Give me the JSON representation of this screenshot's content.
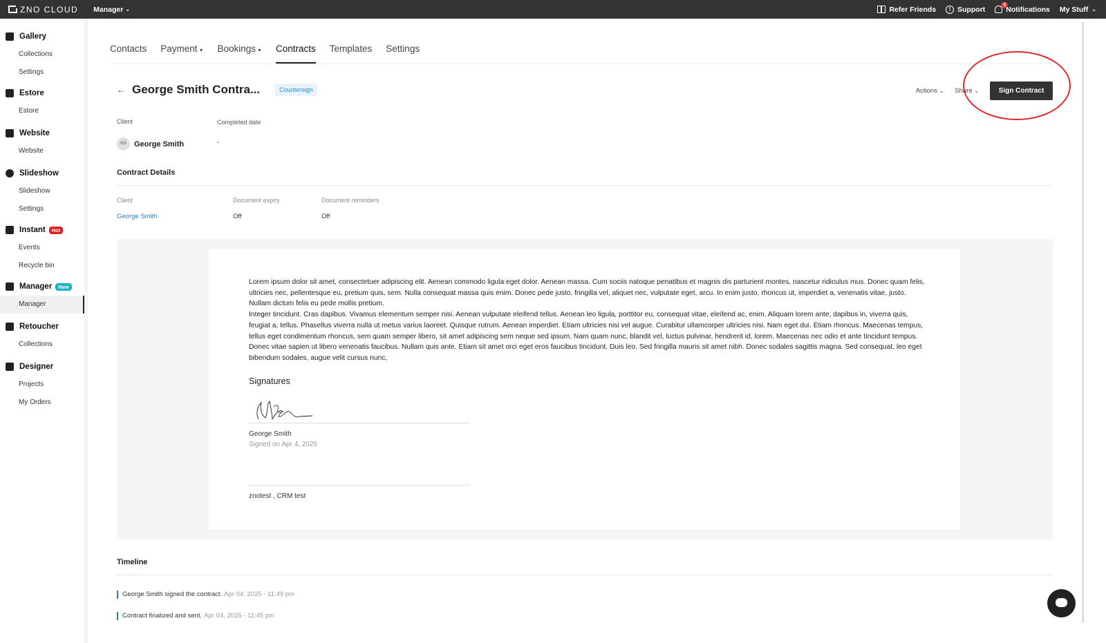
{
  "topbar": {
    "brand": "ZNO CLOUD",
    "module": "Manager",
    "refer": "Refer Friends",
    "support": "Support",
    "notifications": "Notifications",
    "notification_count": "3",
    "my_stuff": "My Stuff"
  },
  "sidebar": {
    "gallery": "Gallery",
    "gallery_collections": "Collections",
    "gallery_settings": "Settings",
    "estore": "Estore",
    "estore_sub": "Estore",
    "website": "Website",
    "website_sub": "Website",
    "slideshow": "Slideshow",
    "slideshow_sub": "Slideshow",
    "slideshow_settings": "Settings",
    "instant": "Instant",
    "instant_badge": "Hot",
    "instant_events": "Events",
    "instant_recycle": "Recycle bin",
    "manager": "Manager",
    "manager_badge": "New",
    "manager_sub": "Manager",
    "retoucher": "Retoucher",
    "retoucher_collections": "Collections",
    "designer": "Designer",
    "designer_projects": "Projects",
    "designer_orders": "My Orders"
  },
  "tabs": {
    "contacts": "Contacts",
    "payment": "Payment",
    "bookings": "Bookings",
    "contracts": "Contracts",
    "templates": "Templates",
    "settings": "Settings"
  },
  "header": {
    "title": "George Smith Contra...",
    "status": "Countersign",
    "actions": "Actions",
    "share": "Share",
    "sign_button": "Sign Contract"
  },
  "info": {
    "client_label": "Client",
    "client_initials": "GS",
    "client_name": "George Smith",
    "completed_label": "Completed date",
    "completed_value": "-"
  },
  "details": {
    "title": "Contract Details",
    "client_label": "Client",
    "client_value": "George Smith",
    "expiry_label": "Document expiry",
    "expiry_value": "Off",
    "reminders_label": "Document reminders",
    "reminders_value": "Off"
  },
  "document": {
    "paragraph1": "Lorem ipsum dolor sit amet, consectetuer adipiscing elit. Aenean commodo ligula eget dolor. Aenean massa. Cum sociis natoque penatibus et magnis dis parturient montes, nascetur ridiculus mus. Donec quam felis, ultricies nec, pellentesque eu, pretium quis, sem. Nulla consequat massa quis enim. Donec pede justo, fringilla vel, aliquet nec, vulputate eget, arcu. In enim justo, rhoncus ut, imperdiet a, venenatis vitae, justo. Nullam dictum felis eu pede mollis pretium.",
    "paragraph2": "Integer tincidunt. Cras dapibus. Vivamus elementum semper nisi. Aenean vulputate eleifend tellus. Aenean leo ligula, porttitor eu, consequat vitae, eleifend ac, enim. Aliquam lorem ante, dapibus in, viverra quis, feugiat a, tellus. Phasellus viverra nulla ut metus varius laoreet. Quisque rutrum. Aenean imperdiet. Etiam ultricies nisi vel augue. Curabitur ullamcorper ultricies nisi. Nam eget dui. Etiam rhoncus. Maecenas tempus, tellus eget condimentum rhoncus, sem quam semper libero, sit amet adipiscing sem neque sed ipsum. Nam quam nunc, blandit vel, luctus pulvinar, hendrerit id, lorem. Maecenas nec odio et ante tincidunt tempus. Donec vitae sapien ut libero venenatis faucibus. Nullam quis ante. Etiam sit amet orci eget eros faucibus tincidunt. Duis leo. Sed fringilla mauris sit amet nibh. Donec sodales sagittis magna. Sed consequat, leo eget bibendum sodales, augue velit cursus nunc,",
    "signatures_title": "Signatures",
    "signer_name": "George Smith",
    "signed_on": "Signed on Apr 4, 2025",
    "second_party": "znotest , CRM test"
  },
  "timeline": {
    "title": "Timeline",
    "items": [
      {
        "text": "George Smith signed the contract.",
        "time": "Apr 04, 2025 - 11:49 pm"
      },
      {
        "text": "Contract finalized and sent.",
        "time": "Apr 04, 2025 - 11:45 pm"
      }
    ]
  }
}
